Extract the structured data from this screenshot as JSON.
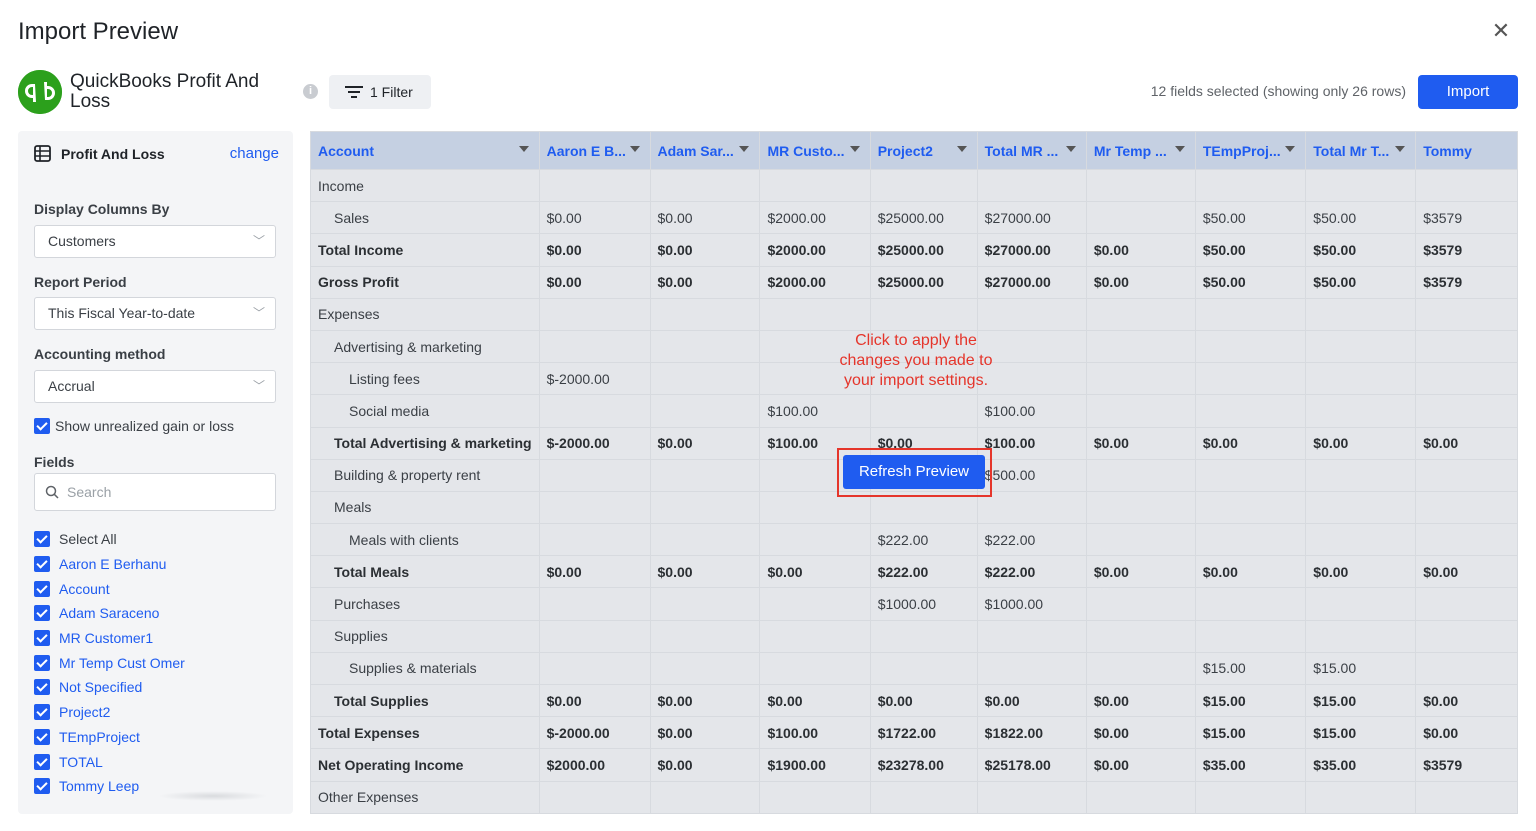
{
  "dialog": {
    "title": "Import Preview"
  },
  "source": {
    "name": "QuickBooks Profit And Loss",
    "brand_color": "#2ca01c"
  },
  "toolbar": {
    "filter_label": "1 Filter",
    "status": "12 fields selected (showing only 26 rows)",
    "import_label": "Import",
    "accent": "#1f5cf0"
  },
  "sidebar": {
    "report_name": "Profit And Loss",
    "change_label": "change",
    "display_columns_label": "Display Columns By",
    "display_columns_value": "Customers",
    "report_period_label": "Report Period",
    "report_period_value": "This Fiscal Year-to-date",
    "accounting_method_label": "Accounting method",
    "accounting_method_value": "Accrual",
    "unrealized_label": "Show unrealized gain or loss",
    "fields_label": "Fields",
    "search_placeholder": "Search",
    "fields": [
      "Select All",
      "Aaron E Berhanu",
      "Account",
      "Adam Saraceno",
      "MR Customer1",
      "Mr Temp Cust Omer",
      "Not Specified",
      "Project2",
      "TEmpProject",
      "TOTAL",
      "Tommy Leep"
    ]
  },
  "grid": {
    "columns": [
      "Account",
      "Aaron E B...",
      "Adam Sar...",
      "MR Custo...",
      "Project2",
      "Total MR ...",
      "Mr Temp ...",
      "TEmpProj...",
      "Total Mr T...",
      "Tommy"
    ],
    "rows": [
      {
        "level": 0,
        "bold": false,
        "cells": [
          "Income",
          "",
          "",
          "",
          "",
          "",
          "",
          "",
          "",
          ""
        ]
      },
      {
        "level": 1,
        "bold": false,
        "cells": [
          "Sales",
          "$0.00",
          "$0.00",
          "$2000.00",
          "$25000.00",
          "$27000.00",
          "",
          "$50.00",
          "$50.00",
          "$3579"
        ]
      },
      {
        "level": 0,
        "bold": true,
        "cells": [
          "Total Income",
          "$0.00",
          "$0.00",
          "$2000.00",
          "$25000.00",
          "$27000.00",
          "$0.00",
          "$50.00",
          "$50.00",
          "$3579"
        ]
      },
      {
        "level": 0,
        "bold": true,
        "cells": [
          "Gross Profit",
          "$0.00",
          "$0.00",
          "$2000.00",
          "$25000.00",
          "$27000.00",
          "$0.00",
          "$50.00",
          "$50.00",
          "$3579"
        ]
      },
      {
        "level": 0,
        "bold": false,
        "cells": [
          "Expenses",
          "",
          "",
          "",
          "",
          "",
          "",
          "",
          "",
          ""
        ]
      },
      {
        "level": 1,
        "bold": false,
        "cells": [
          "Advertising & marketing",
          "",
          "",
          "",
          "",
          "",
          "",
          "",
          "",
          ""
        ]
      },
      {
        "level": 2,
        "bold": false,
        "cells": [
          "Listing fees",
          "$-2000.00",
          "",
          "",
          "",
          "",
          "",
          "",
          "",
          ""
        ]
      },
      {
        "level": 2,
        "bold": false,
        "cells": [
          "Social media",
          "",
          "",
          "$100.00",
          "",
          "$100.00",
          "",
          "",
          "",
          ""
        ]
      },
      {
        "level": 1,
        "bold": true,
        "cells": [
          "Total Advertising & marketing",
          "$-2000.00",
          "$0.00",
          "$100.00",
          "$0.00",
          "$100.00",
          "$0.00",
          "$0.00",
          "$0.00",
          "$0.00"
        ]
      },
      {
        "level": 1,
        "bold": false,
        "cells": [
          "Building & property rent",
          "",
          "",
          "",
          "",
          "$500.00",
          "",
          "",
          "",
          ""
        ]
      },
      {
        "level": 1,
        "bold": false,
        "cells": [
          "Meals",
          "",
          "",
          "",
          "",
          "",
          "",
          "",
          "",
          ""
        ]
      },
      {
        "level": 2,
        "bold": false,
        "cells": [
          "Meals with clients",
          "",
          "",
          "",
          "$222.00",
          "$222.00",
          "",
          "",
          "",
          ""
        ]
      },
      {
        "level": 1,
        "bold": true,
        "cells": [
          "Total Meals",
          "$0.00",
          "$0.00",
          "$0.00",
          "$222.00",
          "$222.00",
          "$0.00",
          "$0.00",
          "$0.00",
          "$0.00"
        ]
      },
      {
        "level": 1,
        "bold": false,
        "cells": [
          "Purchases",
          "",
          "",
          "",
          "$1000.00",
          "$1000.00",
          "",
          "",
          "",
          ""
        ]
      },
      {
        "level": 1,
        "bold": false,
        "cells": [
          "Supplies",
          "",
          "",
          "",
          "",
          "",
          "",
          "",
          "",
          ""
        ]
      },
      {
        "level": 2,
        "bold": false,
        "cells": [
          "Supplies & materials",
          "",
          "",
          "",
          "",
          "",
          "",
          "$15.00",
          "$15.00",
          ""
        ]
      },
      {
        "level": 1,
        "bold": true,
        "cells": [
          "Total Supplies",
          "$0.00",
          "$0.00",
          "$0.00",
          "$0.00",
          "$0.00",
          "$0.00",
          "$15.00",
          "$15.00",
          "$0.00"
        ]
      },
      {
        "level": 0,
        "bold": true,
        "cells": [
          "Total Expenses",
          "$-2000.00",
          "$0.00",
          "$100.00",
          "$1722.00",
          "$1822.00",
          "$0.00",
          "$15.00",
          "$15.00",
          "$0.00"
        ]
      },
      {
        "level": 0,
        "bold": true,
        "cells": [
          "Net Operating Income",
          "$2000.00",
          "$0.00",
          "$1900.00",
          "$23278.00",
          "$25178.00",
          "$0.00",
          "$35.00",
          "$35.00",
          "$3579"
        ]
      },
      {
        "level": 0,
        "bold": false,
        "cells": [
          "Other Expenses",
          "",
          "",
          "",
          "",
          "",
          "",
          "",
          "",
          ""
        ]
      }
    ]
  },
  "overlay": {
    "note": "Click to apply the changes you made to your import settings.",
    "refresh_label": "Refresh Preview",
    "note_color": "#e5352b"
  }
}
